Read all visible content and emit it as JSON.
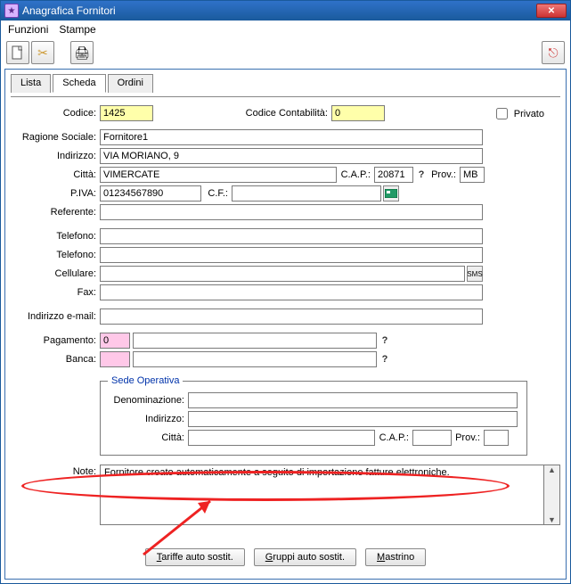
{
  "window": {
    "title": "Anagrafica Fornitori"
  },
  "menu": {
    "funzioni": "Funzioni",
    "stampe": "Stampe"
  },
  "tabs": {
    "lista": "Lista",
    "scheda": "Scheda",
    "ordini": "Ordini"
  },
  "labels": {
    "codice": "Codice:",
    "cod_cont": "Codice Contabilità:",
    "privato": "Privato",
    "rag_soc": "Ragione Sociale:",
    "indirizzo": "Indirizzo:",
    "citta": "Città:",
    "cap": "C.A.P.:",
    "prov": "Prov.:",
    "piva": "P.IVA:",
    "cf": "C.F.:",
    "referente": "Referente:",
    "telefono": "Telefono:",
    "cellulare": "Cellulare:",
    "fax": "Fax:",
    "email": "Indirizzo e-mail:",
    "pagamento": "Pagamento:",
    "banca": "Banca:",
    "sede": "Sede Operativa",
    "denominazione": "Denominazione:",
    "note": "Note:"
  },
  "values": {
    "codice": "1425",
    "cod_cont": "0",
    "rag_soc": "Fornitore1",
    "indirizzo": "VIA MORIANO, 9",
    "citta": "VIMERCATE",
    "cap": "20871",
    "prov": "MB",
    "piva": "01234567890",
    "cf": "",
    "referente": "",
    "tel1": "",
    "tel2": "",
    "cell": "",
    "fax": "",
    "email": "",
    "pagamento_code": "0",
    "pagamento_desc": "",
    "banca_code": "",
    "banca_desc": "",
    "sede_denom": "",
    "sede_ind": "",
    "sede_citta": "",
    "sede_cap": "",
    "sede_prov": "",
    "note": "Fornitore creato automaticamente a seguito di importazione fatture elettroniche."
  },
  "buttons": {
    "tariffe": "Tariffe auto sostit.",
    "gruppi": "Gruppi auto sostit.",
    "mastrino": "Mastrino"
  }
}
